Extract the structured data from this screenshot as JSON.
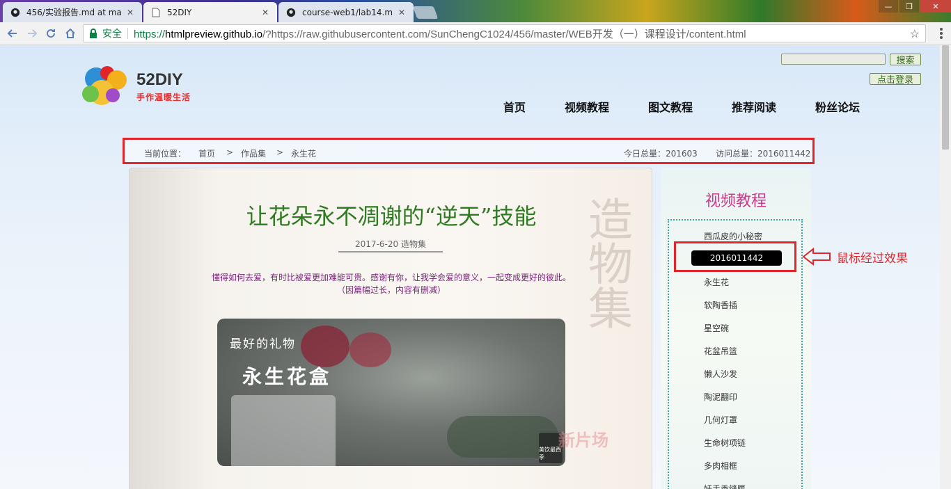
{
  "browser": {
    "tabs": [
      {
        "title": "456/实验报告.md at ma",
        "icon": "github-icon"
      },
      {
        "title": "52DIY",
        "icon": "page-icon"
      },
      {
        "title": "course-web1/lab14.m",
        "icon": "github-icon"
      }
    ],
    "security_label": "安全",
    "url": {
      "proto": "https://",
      "host": "htmlpreview.github.io",
      "rest": "/?https://raw.githubusercontent.com/SunChengC1024/456/master/WEB开发（一）课程设计/content.html"
    }
  },
  "header": {
    "logo_title": "52DIY",
    "logo_subtitle": "手作温暖生活",
    "search_button": "搜索",
    "login_button": "点击登录",
    "nav": [
      "首页",
      "视频教程",
      "图文教程",
      "推荐阅读",
      "粉丝论坛"
    ]
  },
  "breadcrumb": {
    "label": "当前位置：",
    "items": [
      "首页",
      "作品集",
      "永生花"
    ],
    "separator": ">",
    "today_total": "今日总量：201603",
    "visit_total": "访问总量：2016011442"
  },
  "article": {
    "title": "让花朵永不凋谢的“逆天”技能",
    "meta": "2017-6-20 造物集",
    "intro_line1": "懂得如何去爱，有时比被爱更加难能可贵。感谢有你，让我学会爱的意义，一起变成更好的彼此。",
    "intro_line2": "（因篇幅过长，内容有删减）",
    "deco_text": "造物集",
    "video_caption1": "最好的礼物",
    "video_caption2": "永生花盒",
    "video_mark": "美饮最西季",
    "watermark": "新片场"
  },
  "sidebar": {
    "title": "视频教程",
    "items": [
      "西瓜皮的小秘密",
      "永生花",
      "软陶香插",
      "星空碗",
      "花盆吊篮",
      "懒人沙发",
      "陶泥翻印",
      "几何灯罩",
      "生命树项链",
      "多肉相框",
      "奸手香缝匣"
    ],
    "hover_text": "2016011442"
  },
  "annotation": {
    "text": "鼠标经过效果",
    "color": "#e0262b"
  }
}
